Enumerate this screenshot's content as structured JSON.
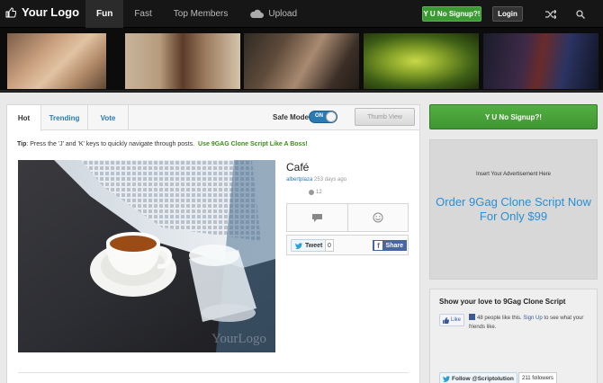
{
  "header": {
    "logo_text": "Your Logo",
    "nav": [
      {
        "label": "Fun",
        "active": true
      },
      {
        "label": "Fast",
        "active": false
      },
      {
        "label": "Top Members",
        "active": false
      },
      {
        "label": "Upload",
        "active": false
      }
    ],
    "signup_label": "Y U No Signup?!",
    "login_label": "Login",
    "icons": {
      "logo": "thumbs-up-icon",
      "upload": "cloud-icon",
      "random": "shuffle-icon",
      "search": "search-icon"
    }
  },
  "featured_count": 5,
  "toolbar": {
    "tabs": [
      {
        "label": "Hot",
        "active": true
      },
      {
        "label": "Trending",
        "active": false
      },
      {
        "label": "Vote",
        "active": false
      }
    ],
    "safe_mode_label": "Safe Mode",
    "safe_mode_state": "ON",
    "thumb_view_label": "Thumb View"
  },
  "tip": {
    "prefix": "Tip",
    "text": ": Press the 'J' and 'K' keys to quickly navigate through posts.",
    "link": "Use 9GAG Clone Script Like A Boss!"
  },
  "post": {
    "title": "Café",
    "author": "albertplaza",
    "time": "253 days ago",
    "comment_count_1": "",
    "comment_count_2": "12",
    "tweet_label": "Tweet",
    "tweet_count": "0",
    "share_label": "Share",
    "watermark": "YourLogo"
  },
  "sidebar": {
    "signup_label": "Y U No Signup?!",
    "ad_small": "Insert Your Advertisement Here",
    "ad_big": "Order 9Gag Clone Script Now For Only $99",
    "fb_title": "Show your love to 9Gag Clone Script",
    "like_label": "Like",
    "like_count_text": "48 people like this.",
    "like_signup": "Sign Up",
    "like_rest": "to see what your friends like.",
    "follow_label": "Follow @Scriptolution",
    "follow_count": "211 followers"
  },
  "colors": {
    "accent_green": "#3a9b33",
    "link_blue": "#2a7ab3",
    "ad_blue": "#2a8fd4",
    "header_bg": "#161616"
  }
}
